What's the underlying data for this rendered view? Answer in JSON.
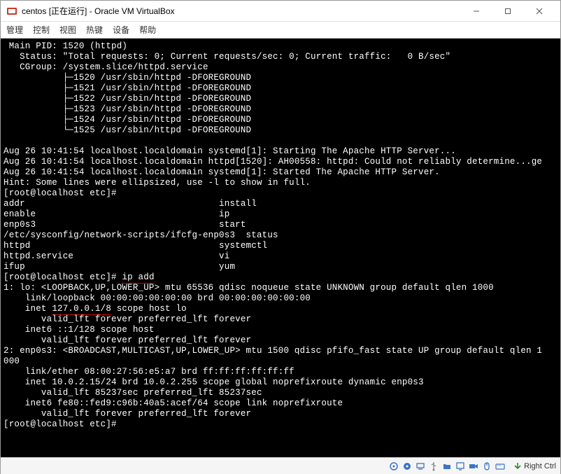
{
  "window": {
    "title": "centos [正在运行] - Oracle VM VirtualBox"
  },
  "menu": {
    "items": [
      "管理",
      "控制",
      "视图",
      "热键",
      "设备",
      "帮助"
    ]
  },
  "terminal": {
    "lines": [
      " Main PID: 1520 (httpd)",
      "   Status: \"Total requests: 0; Current requests/sec: 0; Current traffic:   0 B/sec\"",
      "   CGroup: /system.slice/httpd.service",
      "           ├─1520 /usr/sbin/httpd -DFOREGROUND",
      "           ├─1521 /usr/sbin/httpd -DFOREGROUND",
      "           ├─1522 /usr/sbin/httpd -DFOREGROUND",
      "           ├─1523 /usr/sbin/httpd -DFOREGROUND",
      "           ├─1524 /usr/sbin/httpd -DFOREGROUND",
      "           └─1525 /usr/sbin/httpd -DFOREGROUND",
      "",
      "Aug 26 10:41:54 localhost.localdomain systemd[1]: Starting The Apache HTTP Server...",
      "Aug 26 10:41:54 localhost.localdomain httpd[1520]: AH00558: httpd: Could not reliably determine...ge",
      "Aug 26 10:41:54 localhost.localdomain systemd[1]: Started The Apache HTTP Server.",
      "Hint: Some lines were ellipsized, use -l to show in full.",
      "[root@localhost etc]#",
      "addr                                    install",
      "enable                                  ip",
      "enp0s3                                  start",
      "/etc/sysconfig/network-scripts/ifcfg-enp0s3  status",
      "httpd                                   systemctl",
      "httpd.service                           vi",
      "ifup                                    yum"
    ],
    "prompt_ip": "[root@localhost etc]# ",
    "cmd_ip": "ip add",
    "ip_output_1": [
      "1: lo: <LOOPBACK,UP,LOWER_UP> mtu 65536 qdisc noqueue state UNKNOWN group default qlen 1000",
      "    link/loopback 00:00:00:00:00:00 brd 00:00:00:00:00:00"
    ],
    "inet_prefix": "    inet ",
    "inet_ip": "127.0.0.1/8",
    "inet_suffix": " scope host lo",
    "ip_output_2": [
      "       valid_lft forever preferred_lft forever",
      "    inet6 ::1/128 scope host",
      "       valid_lft forever preferred_lft forever",
      "2: enp0s3: <BROADCAST,MULTICAST,UP,LOWER_UP> mtu 1500 qdisc pfifo_fast state UP group default qlen 1",
      "000",
      "    link/ether 08:00:27:56:e5:a7 brd ff:ff:ff:ff:ff:ff",
      "    inet 10.0.2.15/24 brd 10.0.2.255 scope global noprefixroute dynamic enp0s3",
      "       valid_lft 85237sec preferred_lft 85237sec",
      "    inet6 fe80::fed9:c96b:40a5:acef/64 scope link noprefixroute",
      "       valid_lft forever preferred_lft forever",
      "[root@localhost etc]#"
    ]
  },
  "statusbar": {
    "host_key": "Right Ctrl"
  },
  "icons": {
    "disk": "disk-icon",
    "optical": "optical-icon",
    "audio": "audio-icon",
    "net": "network-icon",
    "usb": "usb-icon",
    "shared": "shared-folder-icon",
    "display": "display-icon",
    "record": "record-icon",
    "mouse": "mouse-capture-icon",
    "hostkey": "hostkey-arrow-icon"
  }
}
